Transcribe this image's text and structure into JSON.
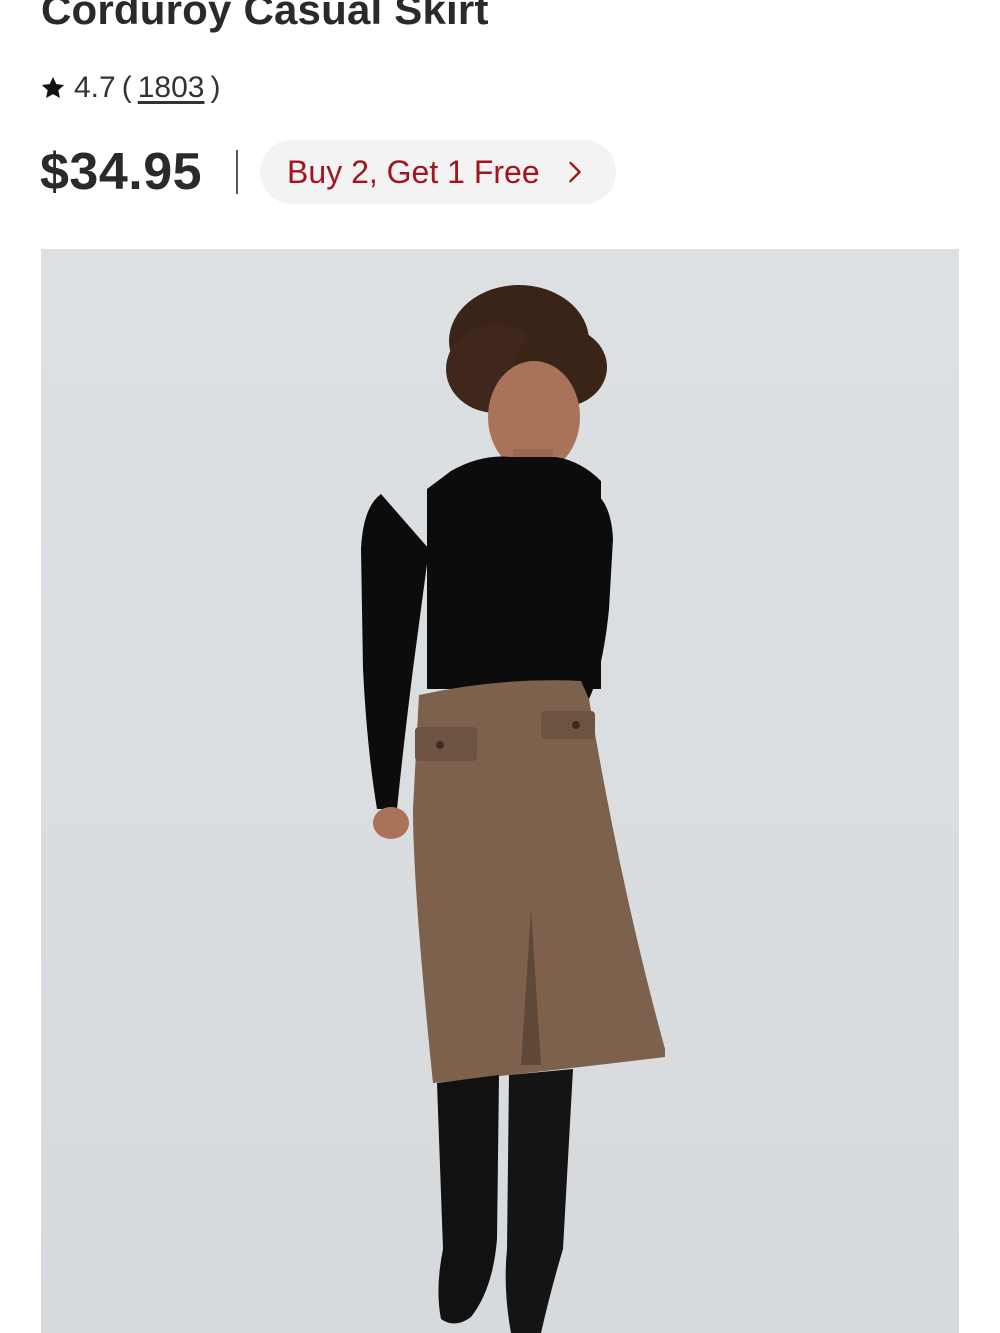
{
  "product": {
    "title": "Corduroy Casual Skirt",
    "rating": "4.7",
    "rating_open": "(",
    "review_count": "1803",
    "rating_close": ")",
    "price": "$34.95",
    "promo_label": "Buy 2, Get 1 Free",
    "icons": {
      "rating": "star-icon",
      "promo": "chevron-right-icon"
    },
    "image": {
      "description_name": "product-photo",
      "background_color": "#dadde0"
    }
  },
  "colors": {
    "promo_text": "#a3141e",
    "promo_bg": "#f3f3f3",
    "title_text": "#2a2a2a"
  }
}
